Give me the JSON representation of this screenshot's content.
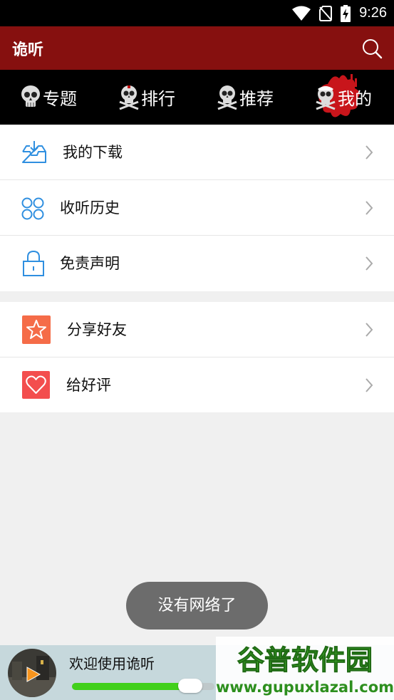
{
  "status_bar": {
    "time": "9:26",
    "icons": [
      "wifi-icon",
      "no-sim-icon",
      "battery-charging-icon"
    ]
  },
  "app_bar": {
    "title": "诡听",
    "search_icon": "search-icon"
  },
  "tabs": [
    {
      "label": "专题",
      "icon": "skull-icon"
    },
    {
      "label": "排行",
      "icon": "skull-crossbones-icon"
    },
    {
      "label": "推荐",
      "icon": "skull-crossbones-icon"
    },
    {
      "label": "我的",
      "icon": "skull-nurse-icon",
      "selected": true
    }
  ],
  "menu_group_1": [
    {
      "label": "我的下载",
      "icon": "download-tray-icon"
    },
    {
      "label": "收听历史",
      "icon": "grid-circles-icon"
    },
    {
      "label": "免责声明",
      "icon": "lock-icon"
    }
  ],
  "menu_group_2": [
    {
      "label": "分享好友",
      "icon": "star-icon"
    },
    {
      "label": "给好评",
      "icon": "heart-icon"
    }
  ],
  "toast": {
    "message": "没有网络了"
  },
  "player": {
    "title": "欢迎使用诡听",
    "progress": 0.83
  },
  "watermark": {
    "brand": "谷普软件园",
    "url": "www.gupuxlazal.com"
  },
  "colors": {
    "app_bar": "#86100f",
    "accent_blue": "#2f8fe0",
    "progress": "#41d01b",
    "star_tile": "#f56c48",
    "heart_tile": "#f34e4e"
  }
}
